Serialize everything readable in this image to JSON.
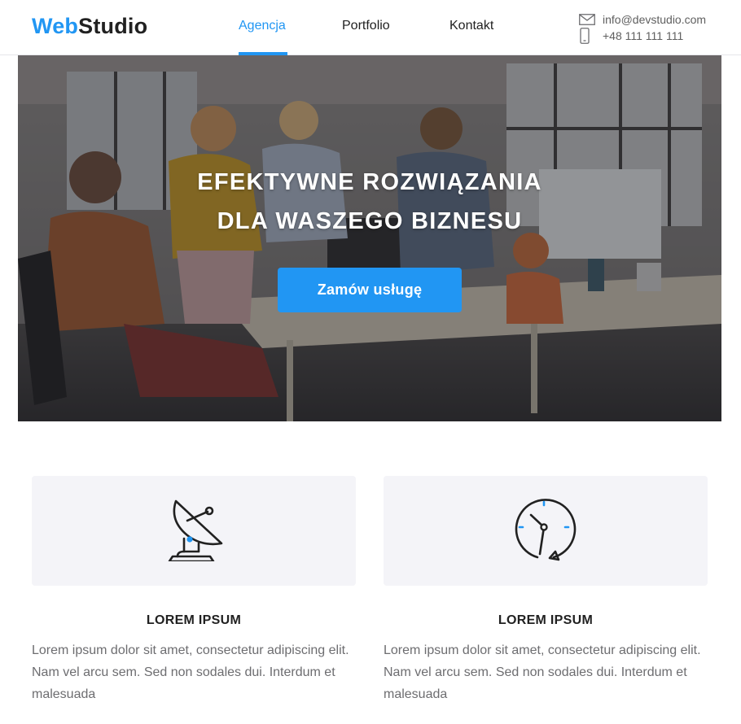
{
  "header": {
    "logo_part1": "Web",
    "logo_part2": "Studio",
    "nav": [
      {
        "label": "Agencja",
        "active": true
      },
      {
        "label": "Portfolio",
        "active": false
      },
      {
        "label": "Kontakt",
        "active": false
      }
    ],
    "email": "info@devstudio.com",
    "phone": "+48 111 111 111",
    "email_icon": "envelope-icon",
    "phone_icon": "smartphone-icon"
  },
  "hero": {
    "title_line1": "EFEKTYWNE ROZWIĄZANIA",
    "title_line2": "DLA WASZEGO BIZNESU",
    "cta_label": "Zamów usługę"
  },
  "features": [
    {
      "icon": "satellite-dish-icon",
      "title": "LOREM IPSUM",
      "text": "Lorem ipsum dolor sit amet, consectetur adipiscing elit. Nam vel arcu sem. Sed non sodales dui. Interdum et malesuada"
    },
    {
      "icon": "clock-icon",
      "title": "LOREM IPSUM",
      "text": "Lorem ipsum dolor sit amet, consectetur adipiscing elit. Nam vel arcu sem. Sed non sodales dui. Interdum et malesuada"
    }
  ],
  "colors": {
    "accent": "#2196f3",
    "text_dark": "#212121",
    "text_muted": "#6d6d70",
    "feature_bg": "#f4f4f8"
  }
}
